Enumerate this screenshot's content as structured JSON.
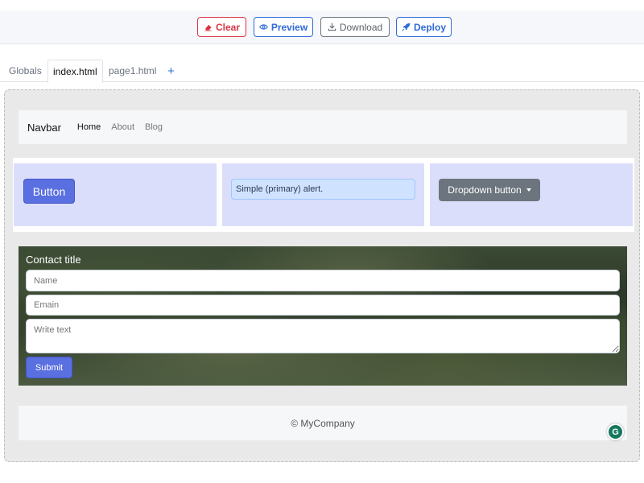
{
  "toolbar": {
    "clear_label": "Clear",
    "preview_label": "Preview",
    "download_label": "Download",
    "deploy_label": "Deploy"
  },
  "tabs": [
    {
      "label": "Globals"
    },
    {
      "label": "index.html",
      "active": true
    },
    {
      "label": "page1.html"
    },
    {
      "label": "+"
    }
  ],
  "navbar": {
    "brand": "Navbar",
    "links": [
      {
        "label": "Home",
        "active": true
      },
      {
        "label": "About"
      },
      {
        "label": "Blog"
      }
    ]
  },
  "components": {
    "button_label": "Button",
    "alert_text": "Simple (primary) alert.",
    "dropdown_label": "Dropdown button"
  },
  "contact": {
    "title": "Contact title",
    "name_placeholder": "Name",
    "email_placeholder": "Emain",
    "text_placeholder": "Write text",
    "submit_label": "Submit"
  },
  "footer": {
    "text": "© MyCompany"
  },
  "grammarly": {
    "glyph": "G"
  },
  "colors": {
    "primary": "#5a6fe0",
    "danger": "#dc3545",
    "link_blue": "#2e6bd8",
    "secondary": "#6c757d",
    "column_bg": "#dbdefb"
  },
  "icons": {
    "clear": "eraser-icon",
    "preview": "eye-icon",
    "download": "download-icon",
    "deploy": "rocket-icon",
    "dropdown": "caret-down-icon"
  }
}
